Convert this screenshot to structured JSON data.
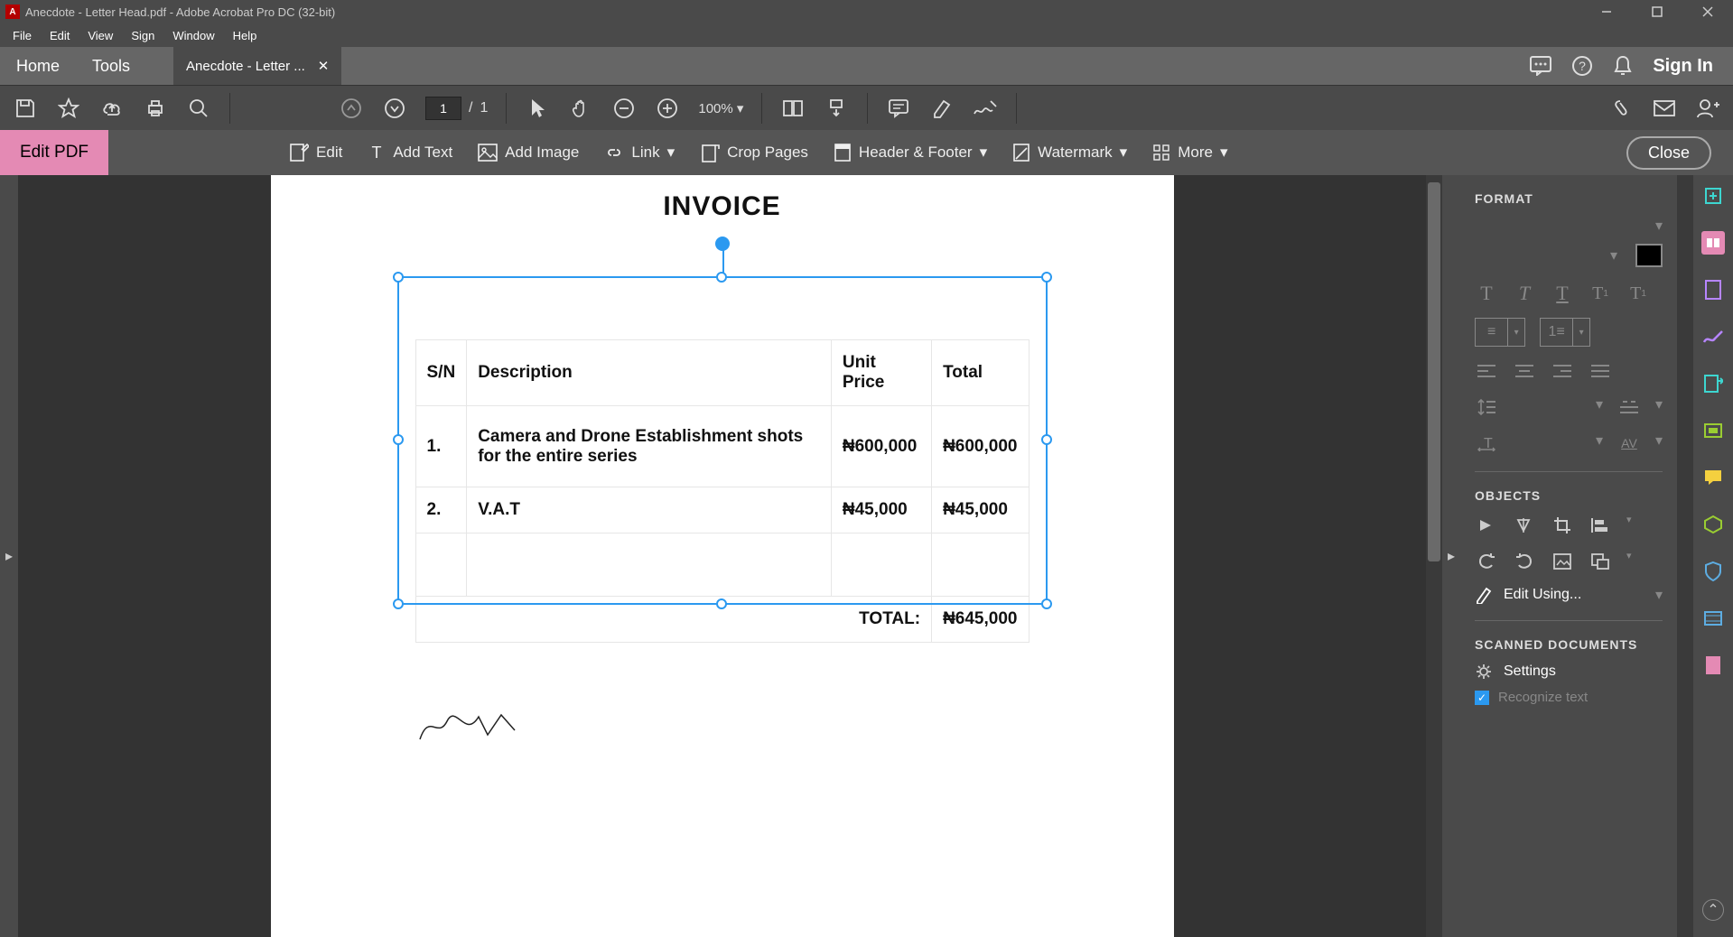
{
  "window": {
    "title": "Anecdote - Letter Head.pdf - Adobe Acrobat Pro DC (32-bit)"
  },
  "menu": {
    "file": "File",
    "edit": "Edit",
    "view": "View",
    "sign": "Sign",
    "window": "Window",
    "help": "Help"
  },
  "tabs": {
    "home": "Home",
    "tools": "Tools",
    "doc": "Anecdote - Letter ...",
    "signin": "Sign In"
  },
  "toolbar": {
    "page_current": "1",
    "page_sep": "/",
    "page_total": "1",
    "zoom": "100%"
  },
  "editbar": {
    "title": "Edit PDF",
    "edit": "Edit",
    "addtext": "Add Text",
    "addimage": "Add Image",
    "link": "Link",
    "crop": "Crop Pages",
    "header": "Header & Footer",
    "watermark": "Watermark",
    "more": "More",
    "close": "Close"
  },
  "document": {
    "title": "INVOICE",
    "headers": {
      "sn": "S/N",
      "desc": "Description",
      "unit": "Unit Price",
      "total": "Total"
    },
    "rows": [
      {
        "sn": "1.",
        "desc": "Camera and Drone Establishment shots for the entire series",
        "unit": "₦600,000",
        "total": "₦600,000"
      },
      {
        "sn": "2.",
        "desc": "V.A.T",
        "unit": "₦45,000",
        "total": "₦45,000"
      }
    ],
    "total_label": "TOTAL:",
    "total_value": "₦645,000"
  },
  "right": {
    "format": "FORMAT",
    "objects": "OBJECTS",
    "editusing": "Edit Using...",
    "scanned": "SCANNED DOCUMENTS",
    "settings": "Settings",
    "recognize": "Recognize text"
  }
}
